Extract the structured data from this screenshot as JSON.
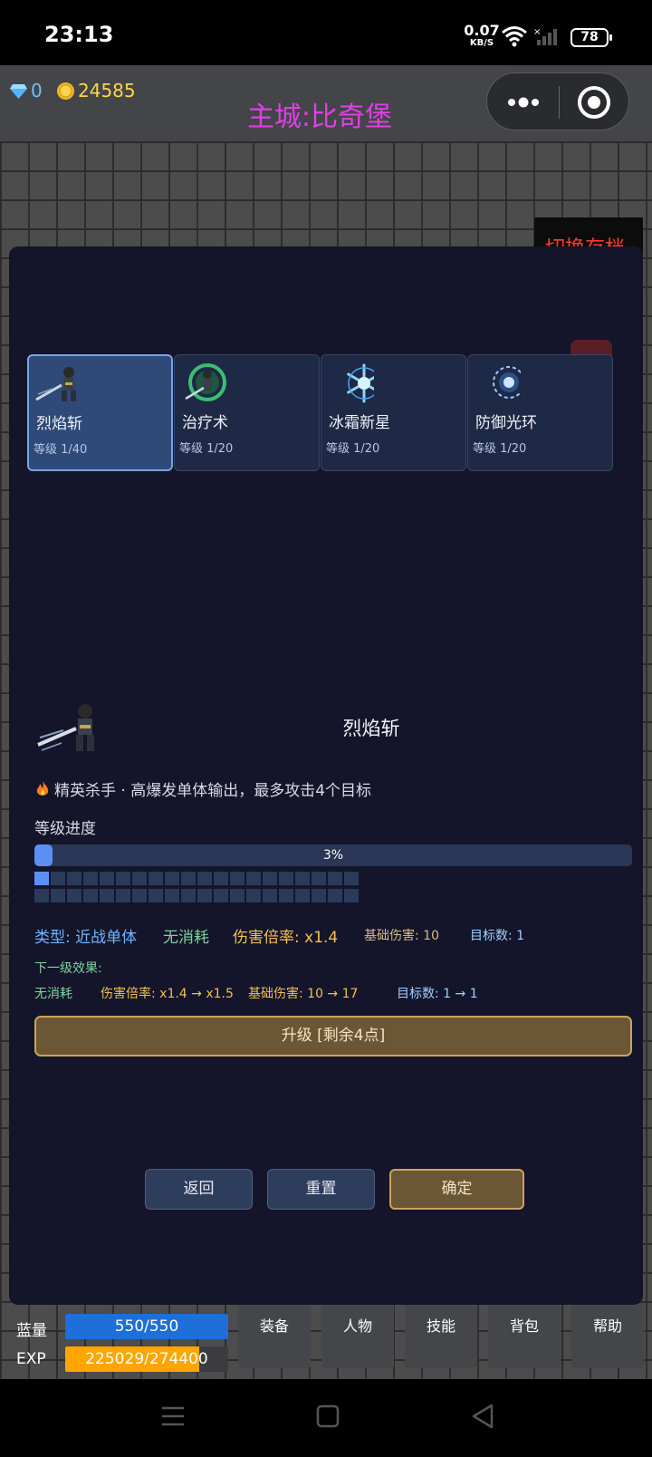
{
  "status_bar": {
    "time": "23:13",
    "net_speed": "0.07",
    "net_unit": "KB/S",
    "battery": "78"
  },
  "header": {
    "gems": "0",
    "gold": "24585",
    "city_title": "主城:比奇堡",
    "switch_save": "切换存档"
  },
  "skills": [
    {
      "name": "烈焰斩",
      "level": "等级 1/40",
      "icon": "sword-warrior-icon",
      "selected": true
    },
    {
      "name": "治疗术",
      "level": "等级 1/20",
      "icon": "green-heal-warrior-icon",
      "selected": false
    },
    {
      "name": "冰霜新星",
      "level": "等级 1/20",
      "icon": "ice-snowflake-icon",
      "selected": false
    },
    {
      "name": "防御光环",
      "level": "等级 1/20",
      "icon": "shield-aura-icon",
      "selected": false
    }
  ],
  "detail": {
    "name": "烈焰斩",
    "description": "精英杀手 · 高爆发单体输出，最多攻击4个目标",
    "level_progress_title": "等级进度",
    "progress_percent": 3,
    "progress_label": "3%",
    "cells_per_row": 20,
    "cells_filled": 1,
    "stats": {
      "type": "类型: 近战单体",
      "cost": "无消耗",
      "damage_multiplier": "伤害倍率: x1.4",
      "base_damage": "基础伤害: 10",
      "targets": "目标数: 1"
    },
    "next_level_title": "下一级效果:",
    "next_level": {
      "cost": "无消耗",
      "damage_multiplier": "伤害倍率: x1.4 → x1.5",
      "base_damage": "基础伤害: 10 → 17",
      "targets": "目标数: 1 → 1"
    },
    "upgrade_label": "升级 [剩余4点]"
  },
  "buttons": {
    "back": "返回",
    "reset": "重置",
    "confirm": "确定"
  },
  "hud": {
    "mana_label": "蓝量",
    "mana_value": "550/550",
    "mana_fraction": 1.0,
    "exp_label": "EXP",
    "exp_value": "225029/274400",
    "exp_fraction": 0.82,
    "tabs": [
      "装备",
      "人物",
      "技能",
      "背包",
      "帮助"
    ]
  },
  "colors": {
    "panel_bg": "#14152a",
    "accent_blue": "#5b8ff5",
    "gold_button": "#6b5635",
    "title_magenta": "#e03fe6",
    "mana_bar": "#1e6fd9",
    "exp_bar": "#ffa500"
  }
}
